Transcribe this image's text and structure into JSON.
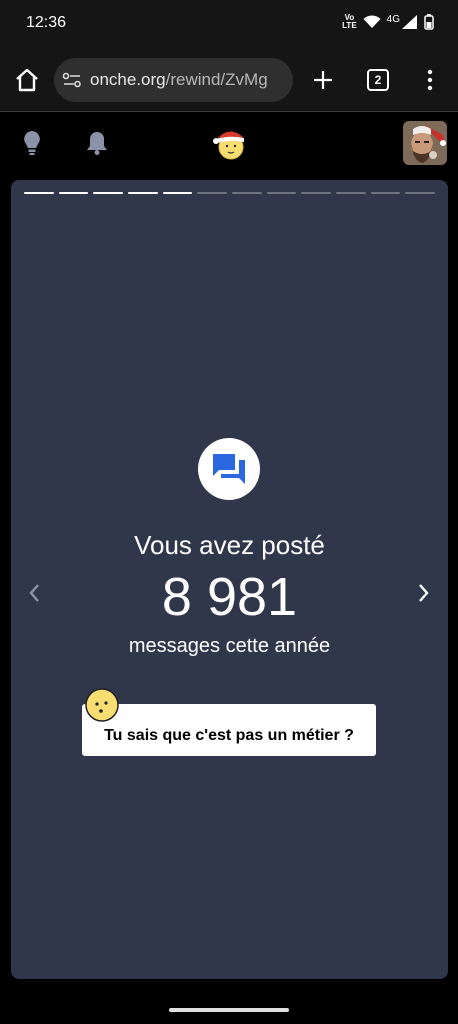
{
  "status_bar": {
    "time": "12:36",
    "volte_top": "Vo",
    "volte_bottom": "LTE",
    "network": "4G"
  },
  "browser": {
    "url_host": "onche.org",
    "url_path": "/rewind/ZvMg",
    "tab_count": "2"
  },
  "story": {
    "segments_total": 12,
    "segments_done": 5,
    "headline": "Vous avez posté",
    "count": "8 981",
    "subline": "messages cette année",
    "quip": "Tu sais que c'est pas un métier ?"
  },
  "colors": {
    "card_bg": "#30374b",
    "accent_blue": "#2a67e0",
    "emoji_yellow": "#f7dd72"
  },
  "icons": [
    "home-icon",
    "site-settings-icon",
    "plus-icon",
    "tab-switcher-icon",
    "more-icon",
    "lightbulb-icon",
    "bell-icon",
    "chat-bubbles-icon",
    "chevron-left-icon",
    "chevron-right-icon"
  ]
}
